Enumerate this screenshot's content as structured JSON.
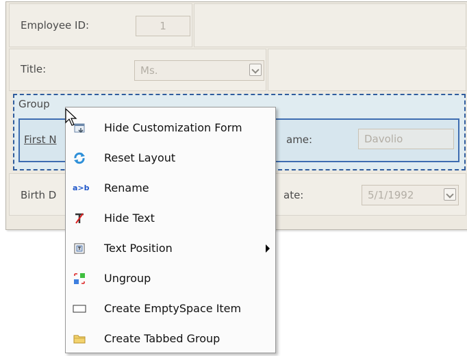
{
  "form": {
    "employee_id_label": "Employee ID:",
    "employee_id_value": "1",
    "title_label": "Title:",
    "title_value": "Ms.",
    "group_label": "Group",
    "first_name_label": "First N",
    "last_name_label": "ame:",
    "last_name_value": "Davolio",
    "birth_date_label": "Birth D",
    "hire_date_label": "ate:",
    "hire_date_value": "5/1/1992"
  },
  "context_menu": {
    "items": [
      {
        "label": "Hide Customization Form",
        "icon": "hide-customization-form-icon"
      },
      {
        "label": "Reset Layout",
        "icon": "reset-layout-icon"
      },
      {
        "label": "Rename",
        "icon": "rename-icon"
      },
      {
        "label": "Hide Text",
        "icon": "hide-text-icon"
      },
      {
        "label": "Text Position",
        "icon": "text-position-icon",
        "has_submenu": true
      },
      {
        "label": "Ungroup",
        "icon": "ungroup-icon"
      },
      {
        "label": "Create EmptySpace Item",
        "icon": "empty-space-item-icon"
      },
      {
        "label": "Create Tabbed Group",
        "icon": "folder-icon"
      }
    ]
  },
  "rename_icon_text": "a>b",
  "colors": {
    "panel_bg": "#ede9e0",
    "group_bg": "#e0ecf1",
    "group_border": "#2f5c9d",
    "menu_bg": "#fbfbfb"
  }
}
